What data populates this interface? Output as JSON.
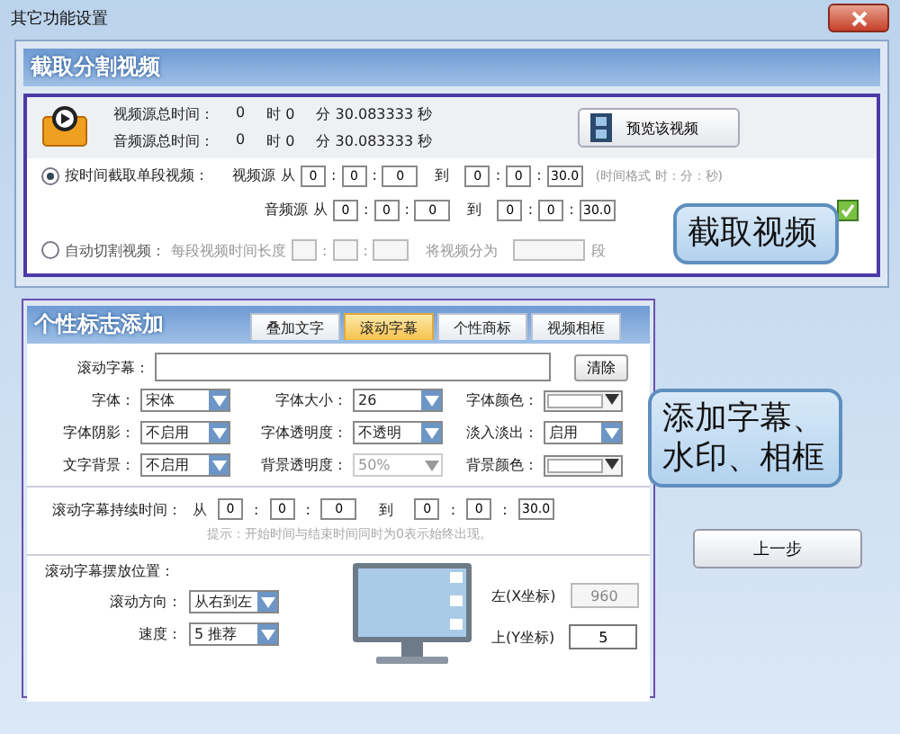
{
  "window": {
    "title": "其它功能设置"
  },
  "cut_section": {
    "title": "截取分割视频",
    "separator": ":",
    "totals": [
      {
        "parts": [
          "视频源总时间：",
          "0",
          "时 0",
          "分 30.083333 秒"
        ]
      },
      {
        "parts": [
          "音频源总时间：",
          "0",
          "时 0",
          "分 30.083333 秒"
        ]
      }
    ],
    "preview_button": "预览该视频",
    "modes": [
      {
        "kind": "range",
        "label": "按时间截取单段视频：",
        "selected": true,
        "rows": [
          {
            "source": "视频源",
            "from_word": "从",
            "from": [
              "0",
              "0",
              "0"
            ],
            "to_word": "到",
            "to": [
              "0",
              "0",
              "30.0"
            ],
            "note": "(时间格式 时：分：秒)"
          },
          {
            "source": "音频源",
            "from_word": "从",
            "from": [
              "0",
              "0",
              "0"
            ],
            "to_word": "到",
            "to": [
              "0",
              "0",
              "30.0"
            ],
            "checked": true
          }
        ]
      },
      {
        "kind": "auto",
        "label": "自动切割视频：",
        "selected": false,
        "length_label": "每段视频时间长度",
        "split_label": "将视频分为",
        "split_unit": "段",
        "disabled": true
      }
    ]
  },
  "logo_section": {
    "title": "个性标志添加",
    "tabs": [
      {
        "label": "叠加文字",
        "selected": false
      },
      {
        "label": "滚动字幕",
        "selected": true
      },
      {
        "label": "个性商标",
        "selected": false
      },
      {
        "label": "视频相框",
        "selected": false
      }
    ],
    "caption": {
      "label": "滚动字幕："
    },
    "clear_button": "清除",
    "options": [
      {
        "kind": "select",
        "label": "字体：",
        "value": "宋体",
        "disabled": false
      },
      {
        "kind": "select",
        "label": "字体大小：",
        "value": "26",
        "disabled": false
      },
      {
        "kind": "color",
        "label": "字体颜色：",
        "color": "#ffffff"
      },
      {
        "kind": "select",
        "label": "字体阴影：",
        "value": "不启用",
        "disabled": false
      },
      {
        "kind": "select",
        "label": "字体透明度：",
        "value": "不透明",
        "disabled": false
      },
      {
        "kind": "select",
        "label": "淡入淡出：",
        "value": "启用",
        "disabled": false
      },
      {
        "kind": "select",
        "label": "文字背景：",
        "value": "不启用",
        "disabled": false
      },
      {
        "kind": "select",
        "label": "背景透明度：",
        "value": "50%",
        "disabled": true
      },
      {
        "kind": "color",
        "label": "背景颜色：",
        "color": "#ffffff"
      }
    ],
    "duration": {
      "label": "滚动字幕持续时间：",
      "from_word": "从",
      "from": [
        "0",
        "0",
        "0"
      ],
      "to_word": "到",
      "to": [
        "0",
        "0",
        "30.0"
      ]
    },
    "hint": "提示：开始时间与结束时间同时为0表示始终出现。",
    "position": {
      "label": "滚动字幕摆放位置：",
      "direction_label": "滚动方向：",
      "direction": "从右到左",
      "speed_label": "速度：",
      "speed": "5 推荐",
      "coords": [
        {
          "label": "左(X坐标)",
          "value": "960",
          "disabled": true
        },
        {
          "label": "上(Y坐标)",
          "value": "5",
          "disabled": false
        }
      ]
    }
  },
  "back_button": "上一步",
  "callouts": [
    {
      "text": "截取视频"
    },
    {
      "text": "添加字幕、水印、相框"
    }
  ]
}
